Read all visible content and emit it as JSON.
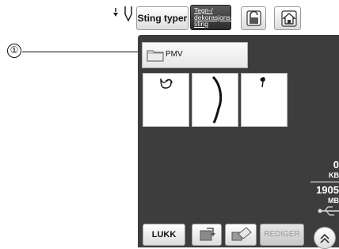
{
  "callout": {
    "number": "①"
  },
  "toolbar": {
    "sting_typer_label": "Sting typer",
    "tegn_label": "Tegn-/\ndekorasjons-\nsting"
  },
  "folder": {
    "label": "PMV"
  },
  "info": {
    "value_top": "0",
    "unit_top": "KB",
    "value_bottom": "1905",
    "unit_bottom": "MB"
  },
  "bottom": {
    "lukk_label": "LUKK",
    "rediger_label": "REDIGER"
  },
  "icons": [
    "needle-position-icon",
    "lock-icon",
    "home-icon",
    "folder-icon",
    "delete-icon",
    "save-icon",
    "usb-icon",
    "arrow-up-icon"
  ],
  "colors": {
    "panel": "#3d3d3d",
    "accent_dark_button": "#2c2c2c"
  }
}
